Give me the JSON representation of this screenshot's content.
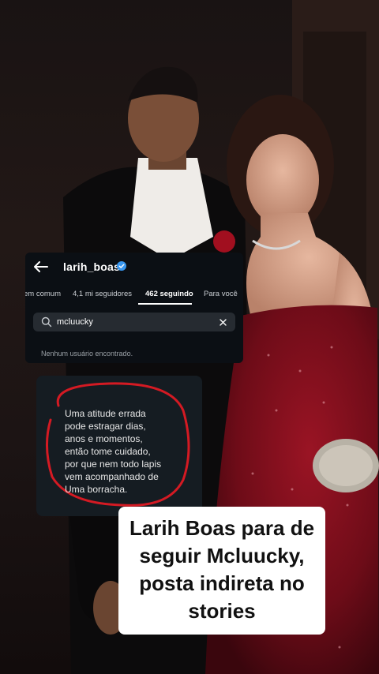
{
  "profile": {
    "username": "larih_boas",
    "verified": true
  },
  "tabs": [
    {
      "label": "em comum",
      "active": false
    },
    {
      "label": "4,1 mi seguidores",
      "active": false
    },
    {
      "label": "462 seguindo",
      "active": true
    },
    {
      "label": "Para você",
      "active": false
    }
  ],
  "search": {
    "value": "mcluucky"
  },
  "results": {
    "empty_message": "Nenhum usuário encontrado."
  },
  "story": {
    "lines": [
      "Uma atitude errada",
      "pode estragar dias,",
      "anos e momentos,",
      "então tome cuidado,",
      "por que nem todo lapis",
      "vem acompanhado de",
      "Uma borracha."
    ]
  },
  "headline": {
    "lines": [
      "Larih Boas para de",
      "seguir Mcluucky,",
      "posta indireta no",
      "stories"
    ]
  },
  "colors": {
    "verified_blue": "#3897f0",
    "dress_red": "#7a0e1c",
    "circle_red": "#d41a23"
  }
}
